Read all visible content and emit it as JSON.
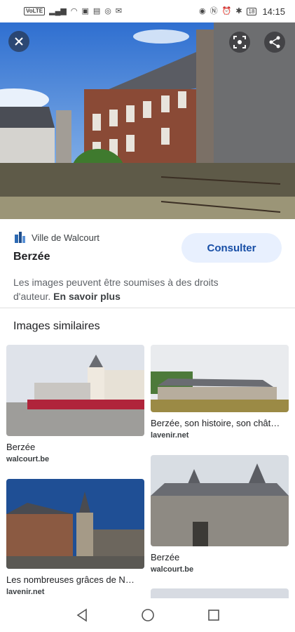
{
  "status_bar": {
    "volte": "VoLTE",
    "time": "14:15",
    "battery": "18"
  },
  "hero": {
    "close_icon": "close-icon",
    "lens_icon": "lens-icon",
    "share_icon": "share-icon"
  },
  "details": {
    "source_name": "Ville de Walcourt",
    "title": "Berzée",
    "consult_label": "Consulter",
    "rights_text": "Les images peuvent être soumises à des droits d'auteur.",
    "learn_more": "En savoir plus"
  },
  "similar": {
    "heading": "Images similaires",
    "items": [
      {
        "caption": "Berzée",
        "domain": "walcourt.be"
      },
      {
        "caption": "Berzée, son histoire, son chât…",
        "domain": "lavenir.net"
      },
      {
        "caption": "Berzée",
        "domain": "walcourt.be"
      },
      {
        "caption": "Les nombreuses grâces de N…",
        "domain": "lavenir.net"
      }
    ]
  },
  "colors": {
    "accent": "#174ea6",
    "consult_bg": "#e8f0fe"
  }
}
